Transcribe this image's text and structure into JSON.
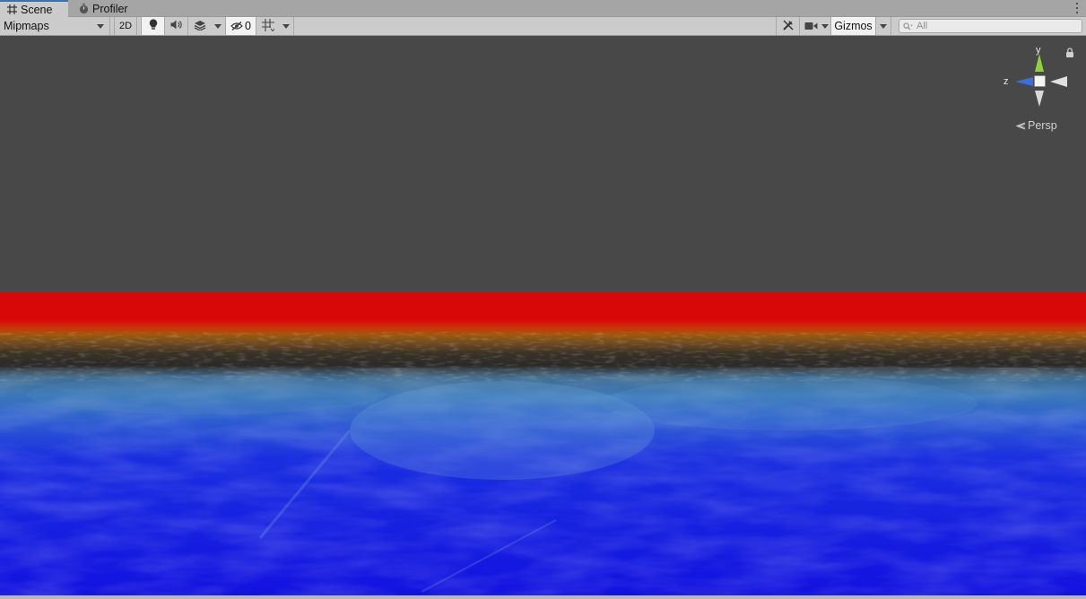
{
  "tabs": [
    {
      "label": "Scene",
      "icon": "grid-icon",
      "active": true
    },
    {
      "label": "Profiler",
      "icon": "stopwatch-icon",
      "active": false
    }
  ],
  "toolbar": {
    "draw_mode": "Mipmaps",
    "mode_2d": "2D",
    "hidden_count": "0",
    "gizmos_label": "Gizmos",
    "search_placeholder": "All"
  },
  "orientation_gizmo": {
    "y_label": "y",
    "z_label": "z",
    "projection": "Persp"
  },
  "colors": {
    "axis_y": "#8fd13a",
    "axis_z": "#3a6fe0",
    "sky": "#484848",
    "band_red": "#d80808",
    "band_blue": "#1212e0"
  }
}
